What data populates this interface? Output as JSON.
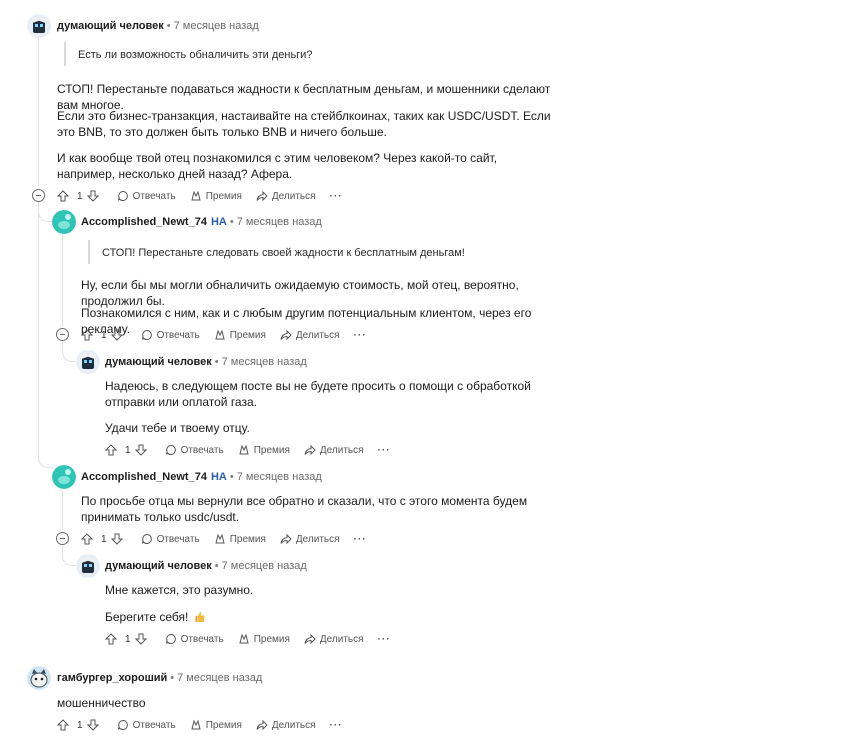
{
  "comments": [
    {
      "author": "думающий человек",
      "time": "7 месяцев назад",
      "quote": "Есть ли возможность обналичить эти деньги?",
      "paragraphs": [
        "СТОП! Перестаньте подаваться жадности к бесплатным деньгам, и мошенники сделают вам многое.",
        "Если это бизнес-транзакция, настаивайте на стейблкоинах, таких как USDC/USDT. Если это BNB, то это должен быть только BNB и ничего больше.",
        "И как вообще твой отец познакомился с этим человеком? Через какой-то сайт, например, несколько дней назад? Афера."
      ],
      "votes": "1"
    },
    {
      "author": "Accomplished_Newt_74",
      "op_badge": "НА",
      "time": "7 месяцев назад",
      "quote": "СТОП! Перестаньте следовать своей жадности к бесплатным деньгам!",
      "paragraphs": [
        "Ну, если бы мы могли обналичить ожидаемую стоимость, мой отец, вероятно, продолжил бы.",
        "Познакомился с ним, как и с любым другим потенциальным клиентом, через его рекламу."
      ],
      "votes": "1"
    },
    {
      "author": "думающий человек",
      "time": "7 месяцев назад",
      "paragraphs": [
        "Надеюсь, в следующем посте вы не будете просить о помощи с обработкой отправки или оплатой газа.",
        "Удачи тебе и твоему отцу."
      ],
      "votes": "1"
    },
    {
      "author": "Accomplished_Newt_74",
      "op_badge": "НА",
      "time": "7 месяцев назад",
      "paragraphs": [
        "По просьбе отца мы вернули все обратно и сказали, что с этого момента будем принимать только usdc/usdt."
      ],
      "votes": "1"
    },
    {
      "author": "думающий человек",
      "time": "7 месяцев назад",
      "paragraphs": [
        "Мне кажется, это разумно.",
        "Берегите себя!"
      ],
      "votes": "1"
    },
    {
      "author": "гамбургер_хороший",
      "time": "7 месяцев назад",
      "paragraphs": [
        "мошенничество"
      ],
      "votes": "1"
    }
  ],
  "actions": {
    "reply": "Отвечать",
    "award": "Премия",
    "share": "Делиться",
    "more": "···"
  },
  "meta_separator": "•",
  "colors": {
    "op_badge": "#2a5db0",
    "thread_line": "#e2e2e2",
    "avatar_teal": "#2ec4b6",
    "text": "#1c1c1c",
    "muted": "#6b6b6b"
  },
  "icons": [
    "upvote-icon",
    "downvote-icon",
    "comment-icon",
    "award-icon",
    "share-icon",
    "more-icon",
    "collapse-icon"
  ]
}
